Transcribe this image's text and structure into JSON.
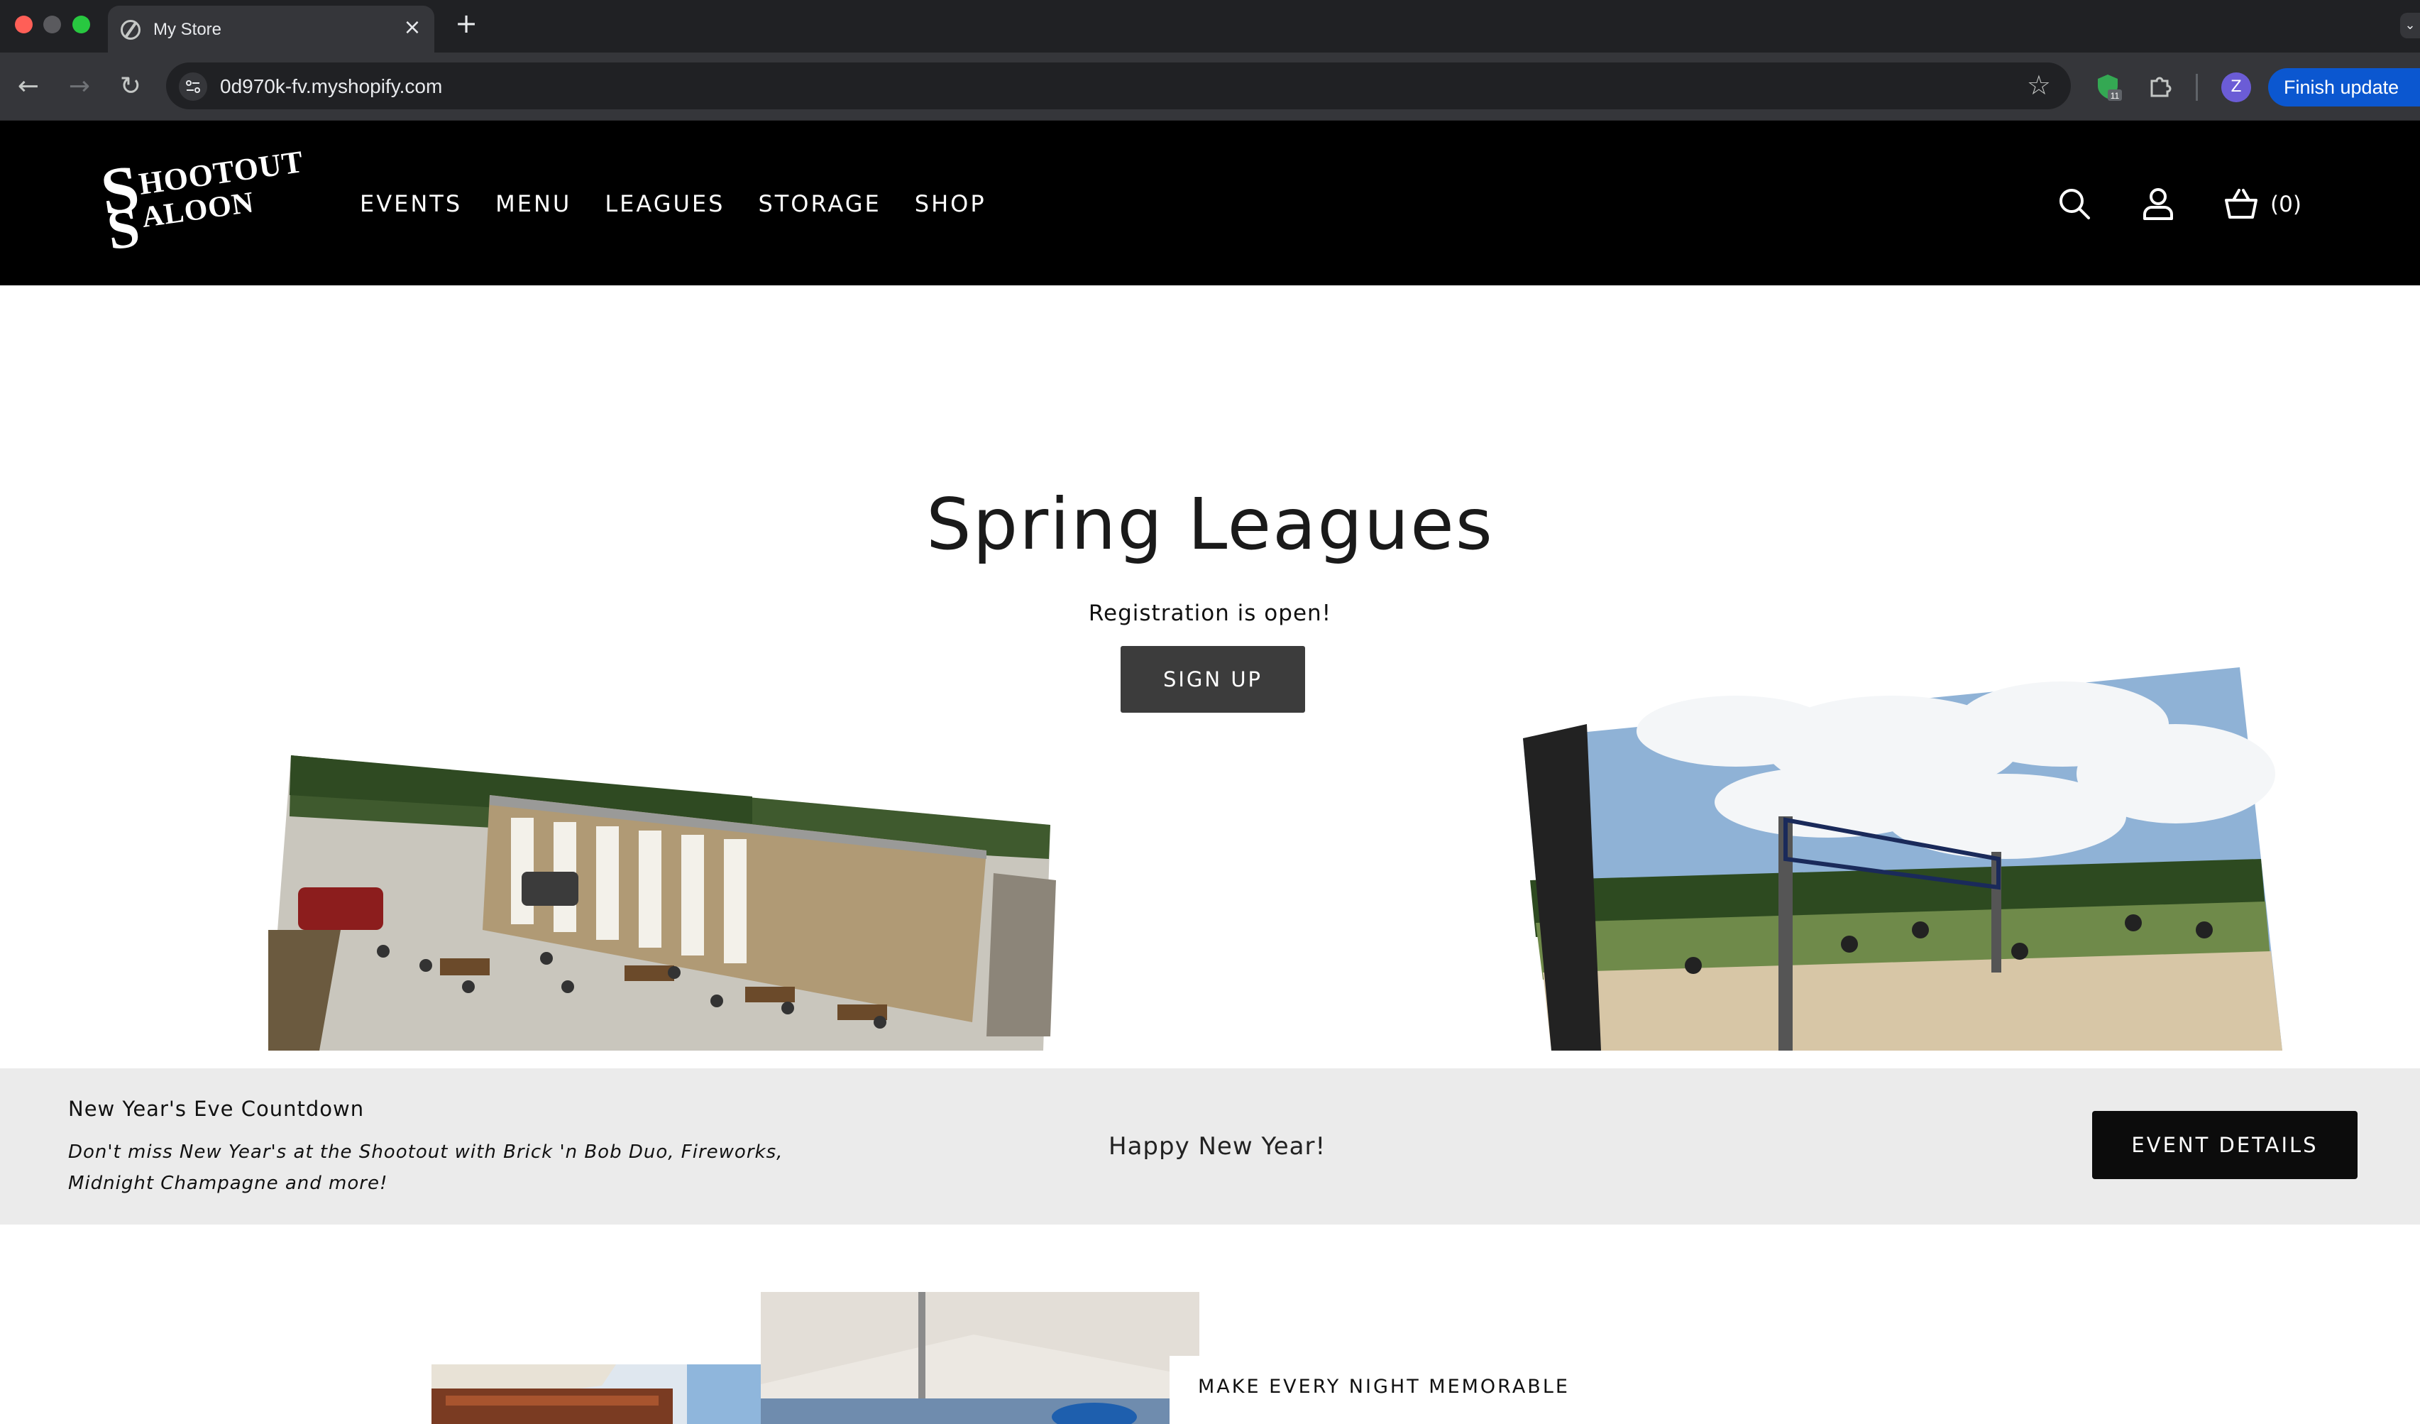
{
  "browser": {
    "tab_title": "My Store",
    "url": "0d970k-fv.myshopify.com",
    "extension_badge": "11",
    "profile_initial": "Z",
    "finish_update_label": "Finish update"
  },
  "header": {
    "logo_text": [
      "SHOOTOUT",
      "SALOON"
    ],
    "nav": [
      "EVENTS",
      "MENU",
      "LEAGUES",
      "STORAGE",
      "SHOP"
    ],
    "cart_count": "(0)"
  },
  "hero": {
    "title": "Spring Leagues",
    "subtitle": "Registration is open!",
    "button_label": "SIGN UP"
  },
  "announcement": {
    "title": "New Year's Eve Countdown",
    "description": "Don't miss New Year's at the Shootout with Brick 'n Bob Duo, Fireworks, Midnight Champagne and more!",
    "center_text": "Happy New Year!",
    "button_label": "EVENT DETAILS"
  },
  "feature": {
    "kicker": "MAKE EVERY NIGHT MEMORABLE",
    "heading_partial": ""
  },
  "colors": {
    "header_bg": "#000000",
    "announcement_bg": "#ebebeb",
    "hero_button_bg": "#3c3c3c",
    "chrome_dark": "#202124",
    "update_button": "#0b57d0"
  }
}
